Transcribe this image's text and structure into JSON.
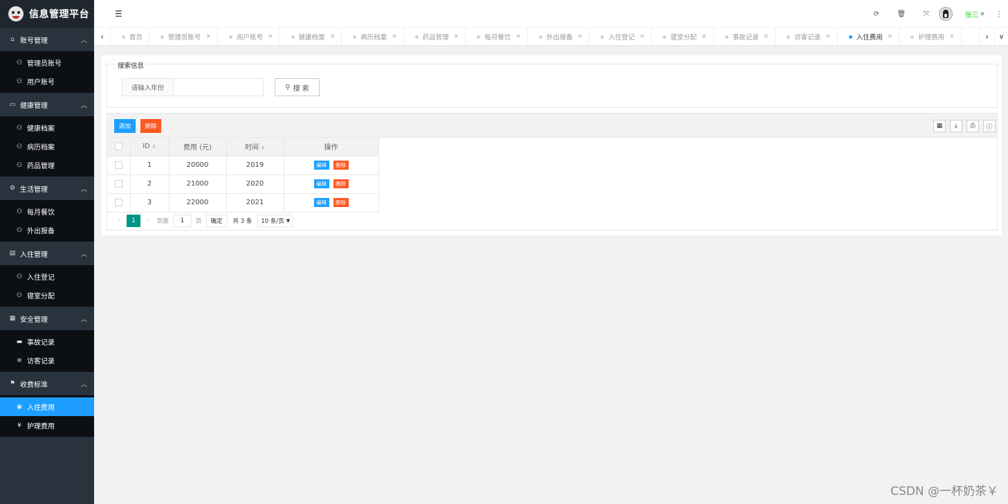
{
  "app": {
    "title": "信息管理平台"
  },
  "sidebar": {
    "groups": [
      {
        "title": "账号管理",
        "icon": "home-icon",
        "items": [
          "管理员账号",
          "用户账号"
        ]
      },
      {
        "title": "健康管理",
        "icon": "window-icon",
        "items": [
          "健康档案",
          "病历档案",
          "药品管理"
        ]
      },
      {
        "title": "生活管理",
        "icon": "cogs-icon",
        "items": [
          "每月餐饮",
          "外出报备"
        ]
      },
      {
        "title": "入住管理",
        "icon": "file-icon",
        "items": [
          "入住登记",
          "寝室分配"
        ]
      },
      {
        "title": "安全管理",
        "icon": "calendar-icon",
        "items": [
          "事故记录",
          "访客记录"
        ]
      },
      {
        "title": "收费标准",
        "icon": "flag-icon",
        "items": [
          "入住费用",
          "护理费用"
        ]
      }
    ],
    "active_item": "入住费用"
  },
  "header": {
    "user_name": "张三",
    "icons": [
      "refresh-icon",
      "trash-icon",
      "fullscreen-icon"
    ]
  },
  "tabs": [
    {
      "label": "首页",
      "closable": false
    },
    {
      "label": "管理员账号",
      "closable": true
    },
    {
      "label": "用户账号",
      "closable": true
    },
    {
      "label": "健康档案",
      "closable": true
    },
    {
      "label": "病历档案",
      "closable": true
    },
    {
      "label": "药品管理",
      "closable": true
    },
    {
      "label": "每月餐饮",
      "closable": true
    },
    {
      "label": "外出报备",
      "closable": true
    },
    {
      "label": "入住登记",
      "closable": true
    },
    {
      "label": "寝室分配",
      "closable": true
    },
    {
      "label": "事故记录",
      "closable": true
    },
    {
      "label": "访客记录",
      "closable": true
    },
    {
      "label": "入住费用",
      "closable": true,
      "active": true
    },
    {
      "label": "护理费用",
      "closable": true
    }
  ],
  "search": {
    "legend": "搜索信息",
    "label": "请输入年份",
    "value": "",
    "button": "搜 索"
  },
  "toolbar": {
    "add": "添加",
    "delete": "删除"
  },
  "table": {
    "columns": [
      "ID",
      "费用 (元)",
      "时间",
      "操作"
    ],
    "rows": [
      {
        "id": "1",
        "fee": "20000",
        "year": "2019"
      },
      {
        "id": "2",
        "fee": "21000",
        "year": "2020"
      },
      {
        "id": "3",
        "fee": "22000",
        "year": "2021"
      }
    ],
    "row_actions": {
      "edit": "编辑",
      "delete": "删除"
    }
  },
  "pager": {
    "current": "1",
    "goto_label": "到第",
    "goto_value": "1",
    "page_label": "页",
    "ok": "确定",
    "total": "共 3 条",
    "page_size": "10 条/页"
  },
  "watermark": "CSDN @一杯奶茶￥"
}
